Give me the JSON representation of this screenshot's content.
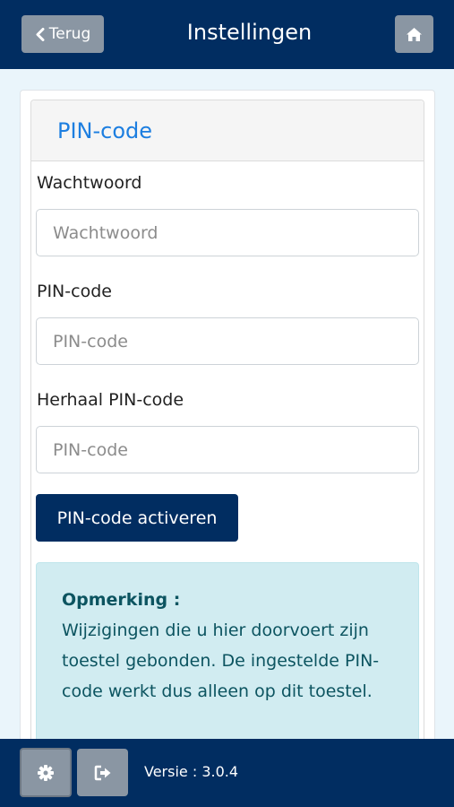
{
  "header": {
    "back_label": "Terug",
    "title": "Instellingen",
    "back_icon": "chevron-left-icon",
    "home_icon": "home-icon"
  },
  "card": {
    "title": "PIN-code"
  },
  "form": {
    "password_label": "Wachtwoord",
    "password_placeholder": "Wachtwoord",
    "password_value": "",
    "pin_label": "PIN-code",
    "pin_placeholder": "PIN-code",
    "pin_value": "",
    "repeat_pin_label": "Herhaal PIN-code",
    "repeat_pin_placeholder": "PIN-code",
    "repeat_pin_value": "",
    "activate_button": "PIN-code activeren"
  },
  "note": {
    "title": "Opmerking :",
    "text": "Wijzigingen die u hier doorvoert zijn toestel gebonden. De ingestelde PIN-code werkt dus alleen op dit toestel."
  },
  "footer": {
    "settings_icon": "gear-icon",
    "logout_icon": "sign-out-icon",
    "version": "Versie : 3.0.4"
  },
  "colors": {
    "navy": "#012d61",
    "button_gray": "#8a96a3",
    "accent_blue": "#1c7ee0",
    "alert_bg": "#d1ecf1",
    "alert_text": "#0c5460",
    "page_bg": "#eaf5fb"
  }
}
